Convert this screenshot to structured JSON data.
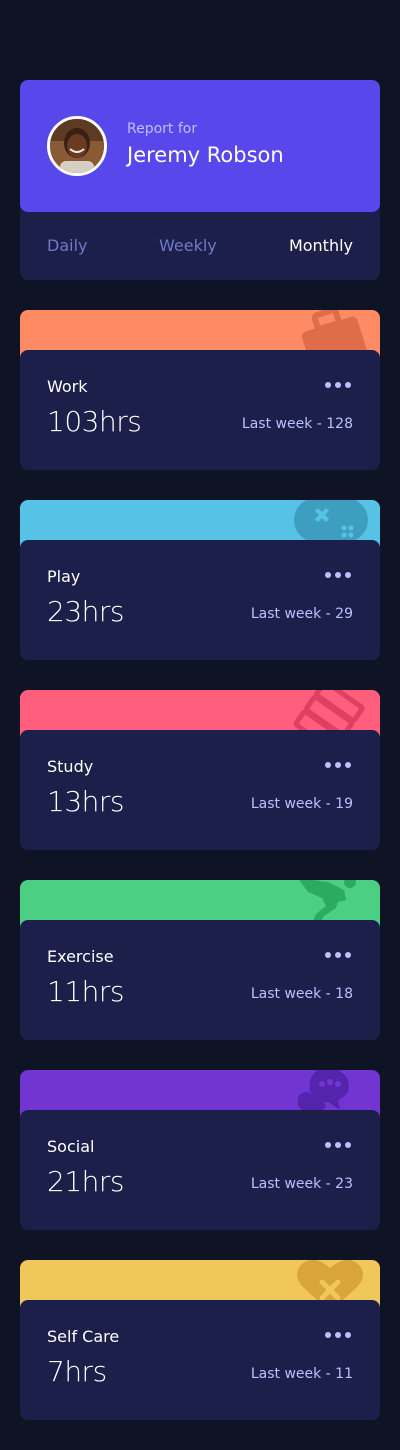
{
  "profile": {
    "report_for": "Report for",
    "name": "Jeremy Robson",
    "tabs": [
      {
        "label": "Daily",
        "active": false
      },
      {
        "label": "Weekly",
        "active": false
      },
      {
        "label": "Monthly",
        "active": true
      }
    ]
  },
  "cards": [
    {
      "title": "Work",
      "hours": "103hrs",
      "previous": "Last week - 128",
      "color": "#ff8b64",
      "icon": "briefcase-icon"
    },
    {
      "title": "Play",
      "hours": "23hrs",
      "previous": "Last week - 29",
      "color": "#55c2e6",
      "icon": "gamepad-icon"
    },
    {
      "title": "Study",
      "hours": "13hrs",
      "previous": "Last week - 19",
      "color": "#ff5e7d",
      "icon": "book-icon"
    },
    {
      "title": "Exercise",
      "hours": "11hrs",
      "previous": "Last week - 18",
      "color": "#4bcf82",
      "icon": "running-figure-icon"
    },
    {
      "title": "Social",
      "hours": "21hrs",
      "previous": "Last week - 23",
      "color": "#7335d2",
      "icon": "speech-bubble-icon"
    },
    {
      "title": "Self Care",
      "hours": "7hrs",
      "previous": "Last week - 11",
      "color": "#f1c75b",
      "icon": "heart-icon"
    }
  ]
}
